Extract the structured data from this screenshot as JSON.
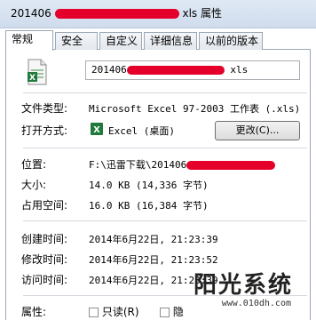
{
  "window": {
    "title_prefix": "201406",
    "title_suffix": "xls 属性"
  },
  "tabs": [
    {
      "label": "常规",
      "active": true
    },
    {
      "label": "安全"
    },
    {
      "label": "自定义"
    },
    {
      "label": "详细信息"
    },
    {
      "label": "以前的版本"
    }
  ],
  "general": {
    "file_name_prefix": "201406",
    "file_name_suffix": "xls",
    "file_type_label": "文件类型:",
    "file_type_value": "Microsoft Excel 97-2003 工作表 (.xls)",
    "open_with_label": "打开方式:",
    "open_with_value": "Excel (桌面)",
    "change_button": "更改(C)...",
    "location_label": "位置:",
    "location_value": "F:\\迅雷下载\\201406",
    "size_label": "大小:",
    "size_value": "14.0 KB (14,336 字节)",
    "disk_size_label": "占用空间:",
    "disk_size_value": "16.0 KB (16,384 字节)",
    "created_label": "创建时间:",
    "created_value": "2014年6月22日, 21:23:39",
    "modified_label": "修改时间:",
    "modified_value": "2014年6月22日, 21:23:52",
    "accessed_label": "访问时间:",
    "accessed_value": "2014年6月22日, 21:23:39",
    "attributes_label": "属性:",
    "readonly_label": "只读(R)",
    "hidden_label": "隐"
  },
  "watermark": {
    "brand": "阳光系统",
    "url": "www.010dh.com"
  },
  "colors": {
    "redaction": "#e4002b",
    "excel_green": "#1f7a3c"
  }
}
